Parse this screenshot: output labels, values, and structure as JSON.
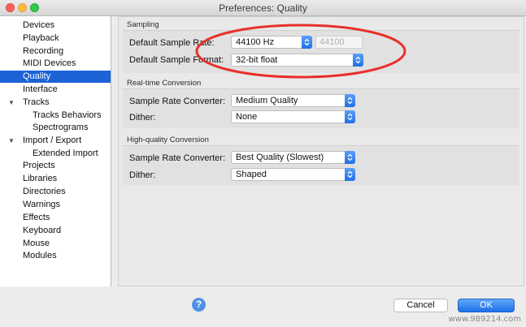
{
  "window": {
    "title": "Preferences: Quality"
  },
  "sidebar": {
    "items": [
      {
        "label": "Devices"
      },
      {
        "label": "Playback"
      },
      {
        "label": "Recording"
      },
      {
        "label": "MIDI Devices"
      },
      {
        "label": "Quality"
      },
      {
        "label": "Interface"
      },
      {
        "label": "Tracks"
      },
      {
        "label": "Tracks Behaviors"
      },
      {
        "label": "Spectrograms"
      },
      {
        "label": "Import / Export"
      },
      {
        "label": "Extended Import"
      },
      {
        "label": "Projects"
      },
      {
        "label": "Libraries"
      },
      {
        "label": "Directories"
      },
      {
        "label": "Warnings"
      },
      {
        "label": "Effects"
      },
      {
        "label": "Keyboard"
      },
      {
        "label": "Mouse"
      },
      {
        "label": "Modules"
      }
    ],
    "selected": "Quality"
  },
  "sampling": {
    "heading": "Sampling",
    "rate_label": "Default Sample Rate:",
    "rate_value": "44100 Hz",
    "rate_custom_value": "44100",
    "format_label": "Default Sample Format:",
    "format_value": "32-bit float"
  },
  "realtime": {
    "heading": "Real-time Conversion",
    "converter_label": "Sample Rate Converter:",
    "converter_value": "Medium Quality",
    "dither_label": "Dither:",
    "dither_value": "None"
  },
  "highquality": {
    "heading": "High-quality Conversion",
    "converter_label": "Sample Rate Converter:",
    "converter_value": "Best Quality (Slowest)",
    "dither_label": "Dither:",
    "dither_value": "Shaped"
  },
  "footer": {
    "help_label": "?",
    "cancel_label": "Cancel",
    "ok_label": "OK"
  },
  "watermark": "www.989214.com",
  "colors": {
    "accent": "#1d62d6",
    "annotation": "#e8302a"
  }
}
